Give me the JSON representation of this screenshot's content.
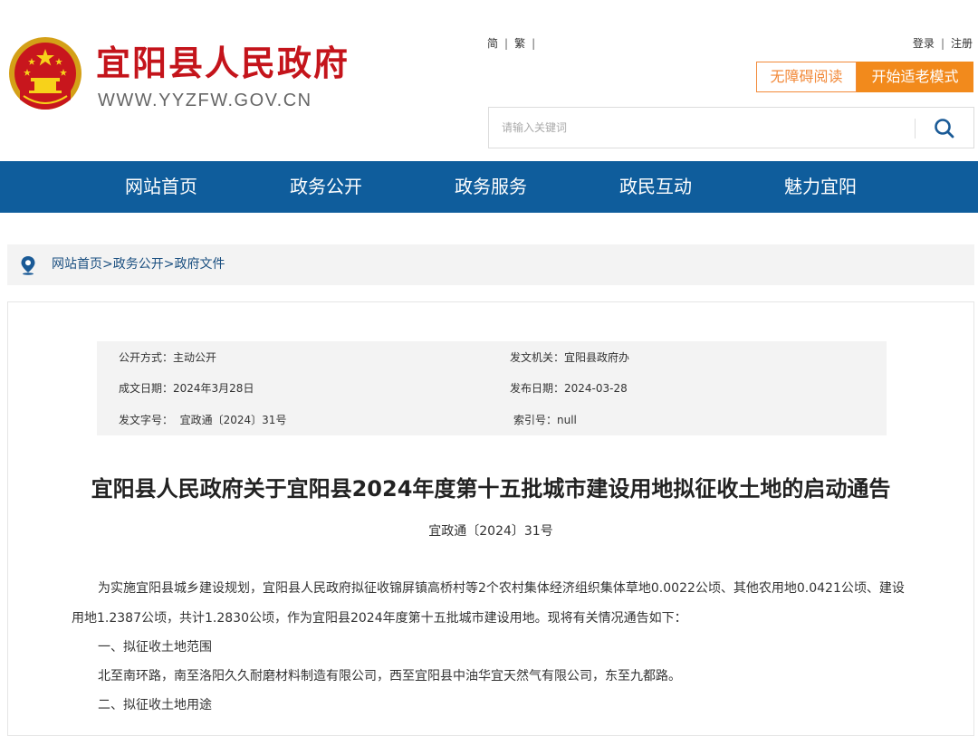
{
  "site": {
    "name": "宜阳县人民政府",
    "url": "WWW.YYZFW.GOV.CN"
  },
  "top_links": {
    "simplified": "简",
    "traditional": "繁",
    "login": "登录",
    "register": "注册"
  },
  "buttons": {
    "accessibility": "无障碍阅读",
    "elder_mode": "开始适老模式"
  },
  "search": {
    "placeholder": "请输入关键词"
  },
  "nav": {
    "items": [
      {
        "label": "网站首页"
      },
      {
        "label": "政务公开"
      },
      {
        "label": "政务服务"
      },
      {
        "label": "政民互动"
      },
      {
        "label": "魅力宜阳"
      }
    ]
  },
  "breadcrumb": {
    "items": [
      "网站首页",
      "政务公开",
      "政府文件"
    ],
    "separator": ">"
  },
  "meta": {
    "disclosure": "公开方式：主动公开",
    "issuer": "发文机关：宜阳县政府办",
    "written_date": "成文日期：2024年3月28日",
    "publish_date": "发布日期：2024-03-28",
    "doc_number": "发文字号：  宜政通〔2024〕31号",
    "index_number": "索引号：null"
  },
  "document": {
    "title": "宜阳县人民政府关于宜阳县2024年度第十五批城市建设用地拟征收土地的启动通告",
    "number": "宜政通〔2024〕31号",
    "paragraph1_line1": "为实施宜阳县城乡建设规划，宜阳县人民政府拟征收锦屏镇高桥村等2个农村集体经济组织集体草地0.0022公顷、其他农用地0.0421公顷、建设",
    "paragraph1_line2": "用地1.2387公顷，共计1.2830公顷，作为宜阳县2024年度第十五批城市建设用地。现将有关情况通告如下：",
    "section1": "一、拟征收土地范围",
    "section1_text": "北至南环路，南至洛阳久久耐磨材料制造有限公司，西至宜阳县中油华宜天然气有限公司，东至九都路。",
    "section2": "二、拟征收土地用途"
  },
  "colors": {
    "brand_red": "#c4141b",
    "nav_blue": "#0f5d9c",
    "accent_orange": "#f28a1c"
  }
}
